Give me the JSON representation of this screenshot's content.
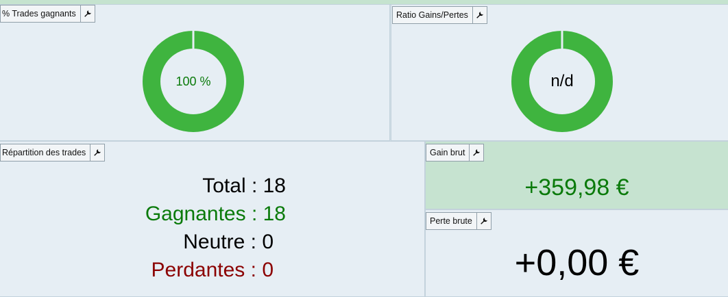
{
  "panels": {
    "trades_gagnants": {
      "title": "% Trades gagnants",
      "value": "100 %",
      "ratio": 1.0,
      "ring_color": "#3fb43f",
      "text_color": "#0a7a0a"
    },
    "ratio": {
      "title": "Ratio Gains/Pertes",
      "value": "n/d",
      "ratio": 1.0,
      "ring_color": "#3fb43f",
      "text_color": "#000000"
    },
    "repartition": {
      "title": "Répartition des trades",
      "rows": [
        {
          "label": "Total",
          "sep": " : ",
          "value": "18",
          "color": "#000000"
        },
        {
          "label": "Gagnantes",
          "sep": " : ",
          "value": "18",
          "color": "#0a7a0a"
        },
        {
          "label": "Neutre",
          "sep": " : ",
          "value": "0",
          "color": "#000000"
        },
        {
          "label": "Perdantes",
          "sep": " : ",
          "value": "0",
          "color": "#8b0000"
        }
      ]
    },
    "gain_brut": {
      "title": "Gain brut",
      "value": "+359,98 €",
      "color": "#0a7a0a"
    },
    "perte_brute": {
      "title": "Perte brute",
      "value": "+0,00 €",
      "color": "#000000"
    }
  },
  "icons": {
    "settings": "wrench-icon"
  }
}
